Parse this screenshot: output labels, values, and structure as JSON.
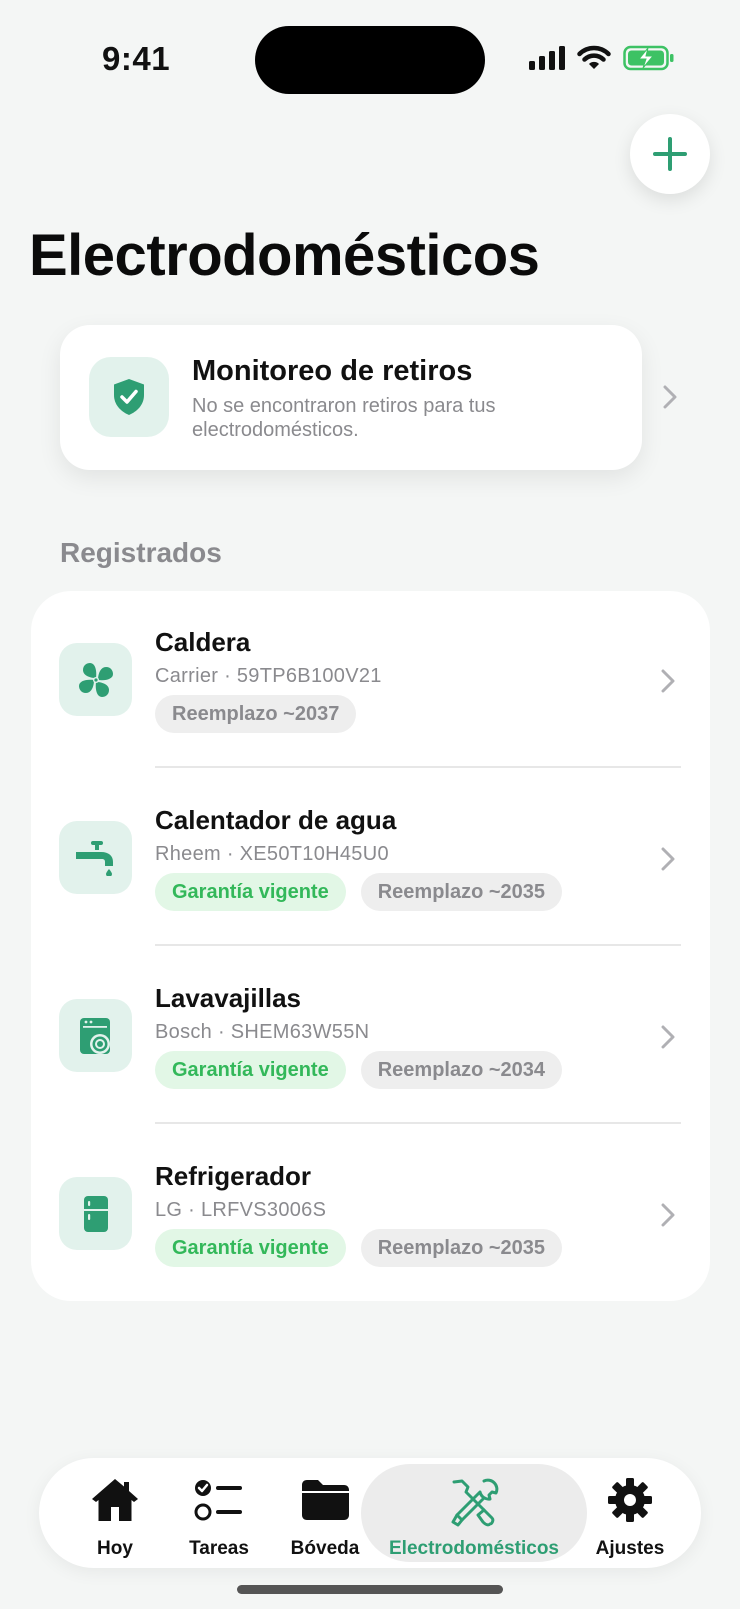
{
  "status_bar": {
    "time": "9:41"
  },
  "header": {
    "title": "Electrodomésticos"
  },
  "recall": {
    "title": "Monitoreo de retiros",
    "subtitle": "No se encontraron retiros para tus electrodomésticos."
  },
  "section": {
    "label": "Registrados"
  },
  "appliances": [
    {
      "name": "Caldera",
      "detail": "Carrier · 59TP6B100V21",
      "warranty": "",
      "replacement": "Reemplazo ~2037",
      "icon": "fan-icon"
    },
    {
      "name": "Calentador de agua",
      "detail": "Rheem · XE50T10H45U0",
      "warranty": "Garantía vigente",
      "replacement": "Reemplazo ~2035",
      "icon": "faucet-icon"
    },
    {
      "name": "Lavavajillas",
      "detail": "Bosch · SHEM63W55N",
      "warranty": "Garantía vigente",
      "replacement": "Reemplazo ~2034",
      "icon": "dishwasher-icon"
    },
    {
      "name": "Refrigerador",
      "detail": "LG · LRFVS3006S",
      "warranty": "Garantía vigente",
      "replacement": "Reemplazo ~2035",
      "icon": "refrigerator-icon"
    }
  ],
  "tabs": [
    {
      "label": "Hoy",
      "icon": "house-icon"
    },
    {
      "label": "Tareas",
      "icon": "checklist-icon"
    },
    {
      "label": "Bóveda",
      "icon": "folder-icon"
    },
    {
      "label": "Electrodomésticos",
      "icon": "wrench-screwdriver-icon",
      "active": true
    },
    {
      "label": "Ajustes",
      "icon": "gear-icon"
    }
  ],
  "colors": {
    "accent": "#2e9e73",
    "icon_bg": "#e2f2ec",
    "warranty_text": "#33b85a",
    "warranty_bg": "#e2f7e6",
    "background": "#f4f6f5"
  }
}
